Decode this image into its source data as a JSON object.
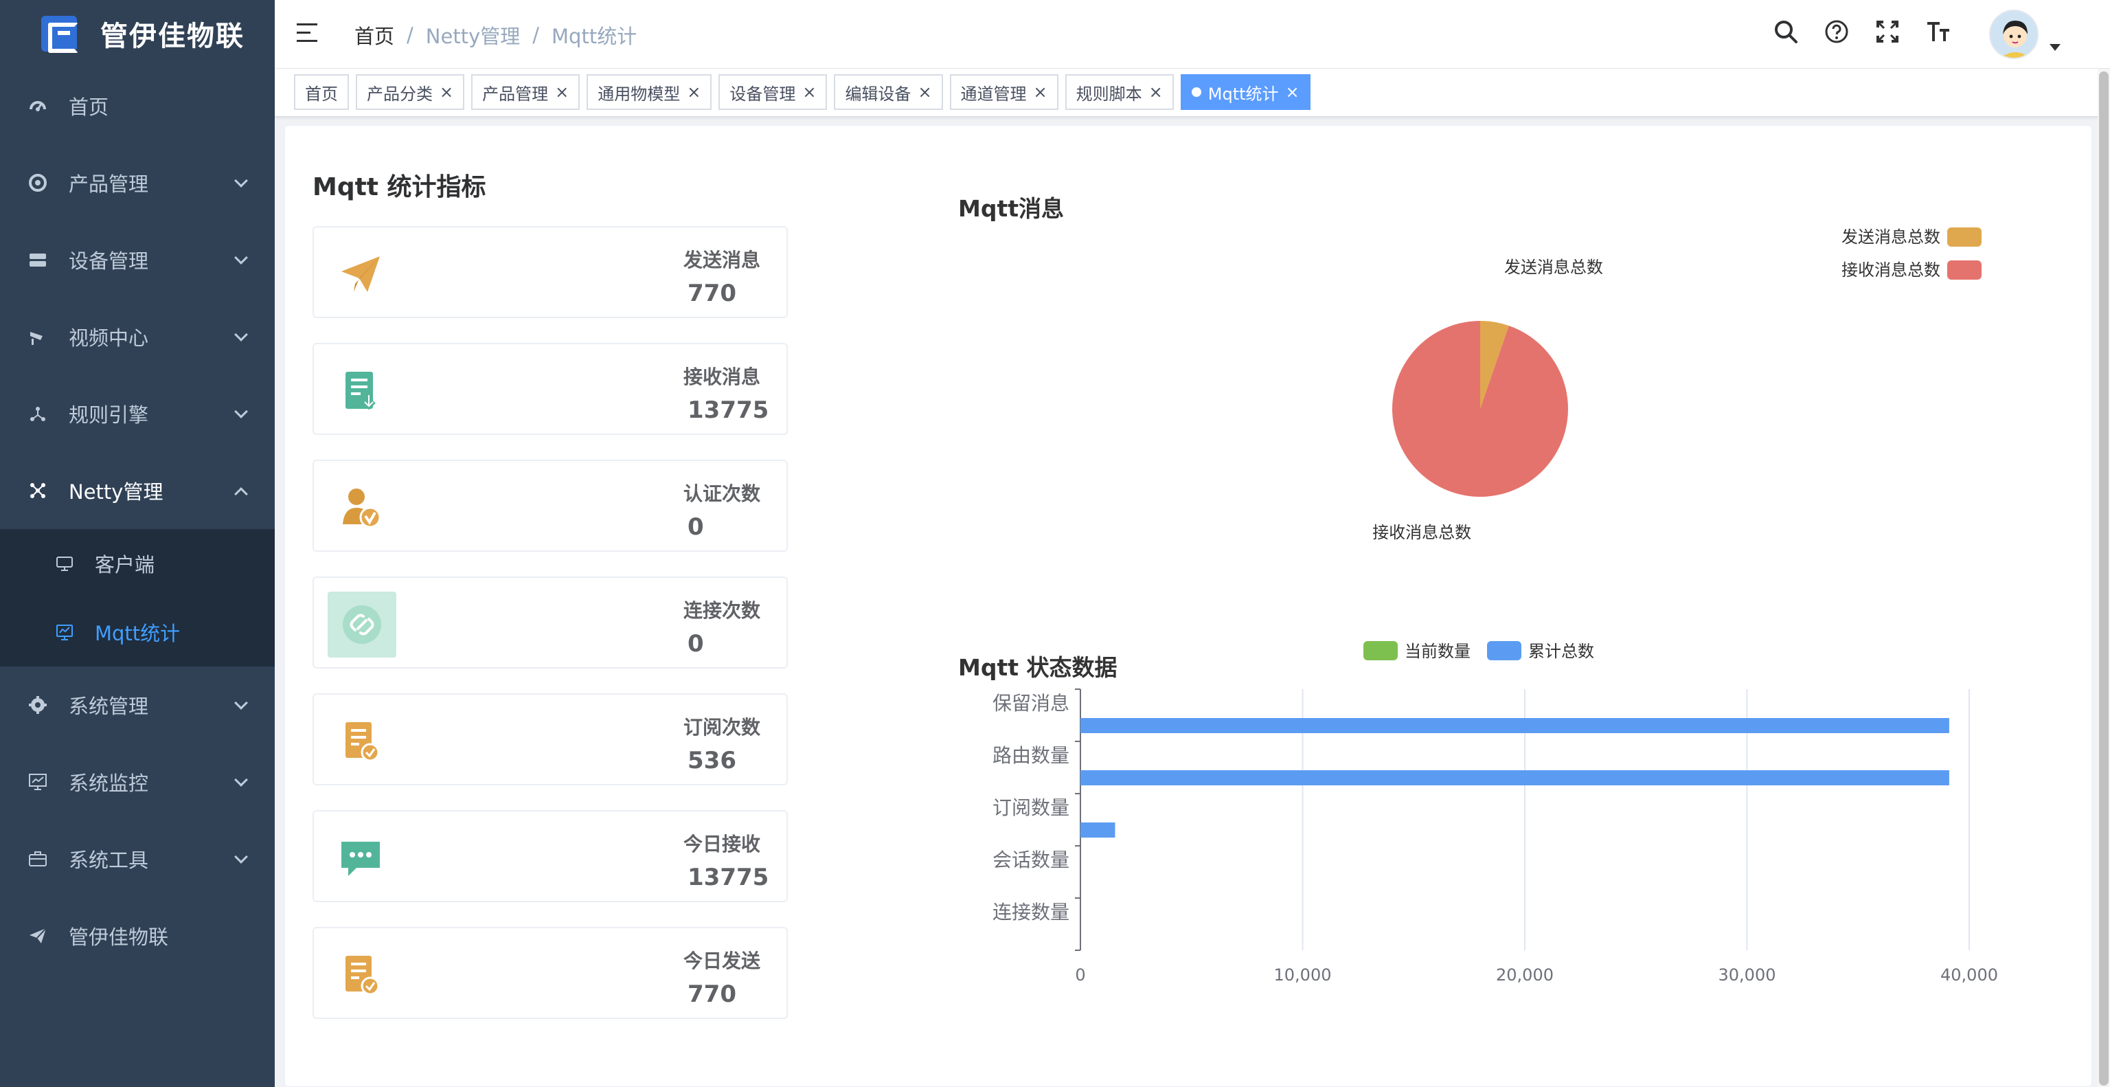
{
  "app": {
    "title": "管伊佳物联"
  },
  "sidebar": {
    "items": [
      {
        "label": "首页",
        "icon": "dashboard-icon"
      },
      {
        "label": "产品管理",
        "icon": "product-icon"
      },
      {
        "label": "设备管理",
        "icon": "device-icon"
      },
      {
        "label": "视频中心",
        "icon": "video-icon"
      },
      {
        "label": "规则引擎",
        "icon": "rule-icon"
      },
      {
        "label": "Netty管理",
        "icon": "netty-icon"
      },
      {
        "label": "系统管理",
        "icon": "settings-icon"
      },
      {
        "label": "系统监控",
        "icon": "monitor-icon"
      },
      {
        "label": "系统工具",
        "icon": "toolbox-icon"
      },
      {
        "label": "管伊佳物联",
        "icon": "paper-plane-icon"
      }
    ],
    "submenu": [
      {
        "label": "客户端",
        "icon": "client-icon"
      },
      {
        "label": "Mqtt统计",
        "icon": "chart-icon"
      }
    ],
    "colors": {
      "background": "#304156",
      "active": "#409eff"
    }
  },
  "header": {
    "breadcrumb": [
      "首页",
      "Netty管理",
      "Mqtt统计"
    ],
    "separator": "/"
  },
  "tags": [
    {
      "label": "首页",
      "closable": false
    },
    {
      "label": "产品分类",
      "closable": true
    },
    {
      "label": "产品管理",
      "closable": true
    },
    {
      "label": "通用物模型",
      "closable": true
    },
    {
      "label": "设备管理",
      "closable": true
    },
    {
      "label": "编辑设备",
      "closable": true
    },
    {
      "label": "通道管理",
      "closable": true
    },
    {
      "label": "规则脚本",
      "closable": true
    },
    {
      "label": "Mqtt统计",
      "closable": true,
      "active": true
    }
  ],
  "stats": {
    "title": "Mqtt 统计指标",
    "cards": [
      {
        "label": "发送消息",
        "value": "770",
        "icon": "send-plane-icon",
        "color": "#e3a64c"
      },
      {
        "label": "接收消息",
        "value": "13775",
        "icon": "receive-document-icon",
        "color": "#52b59a"
      },
      {
        "label": "认证次数",
        "value": "0",
        "icon": "user-verify-icon",
        "color": "#d99a3e"
      },
      {
        "label": "连接次数",
        "value": "0",
        "icon": "link-icon",
        "color": "#52b59a"
      },
      {
        "label": "订阅次数",
        "value": "536",
        "icon": "subscribe-document-icon",
        "color": "#e3a64c"
      },
      {
        "label": "今日接收",
        "value": "13775",
        "icon": "chat-icon",
        "color": "#52b59a"
      },
      {
        "label": "今日发送",
        "value": "770",
        "icon": "send-document-icon",
        "color": "#e3a64c"
      }
    ]
  },
  "chart_data": [
    {
      "type": "pie",
      "title": "Mqtt消息",
      "categories": [
        "发送消息总数",
        "接收消息总数"
      ],
      "values": [
        770,
        13775
      ],
      "colors": [
        "#e0a84e",
        "#e5736d"
      ],
      "legend": "top-right"
    },
    {
      "type": "bar",
      "orientation": "horizontal",
      "title": "Mqtt 状态数据",
      "categories": [
        "保留消息",
        "路由数量",
        "订阅数量",
        "会话数量",
        "连接数量"
      ],
      "series": [
        {
          "name": "当前数量",
          "values": [
            0,
            0,
            0,
            0,
            0
          ],
          "color": "#7ec050"
        },
        {
          "name": "累计总数",
          "values": [
            39100,
            39100,
            1560,
            0,
            0
          ],
          "color": "#5b9cf2"
        }
      ],
      "xlim": [
        0,
        40000
      ],
      "xticks": [
        "0",
        "10,000",
        "20,000",
        "30,000",
        "40,000"
      ],
      "grid": true,
      "legend": "top"
    }
  ]
}
